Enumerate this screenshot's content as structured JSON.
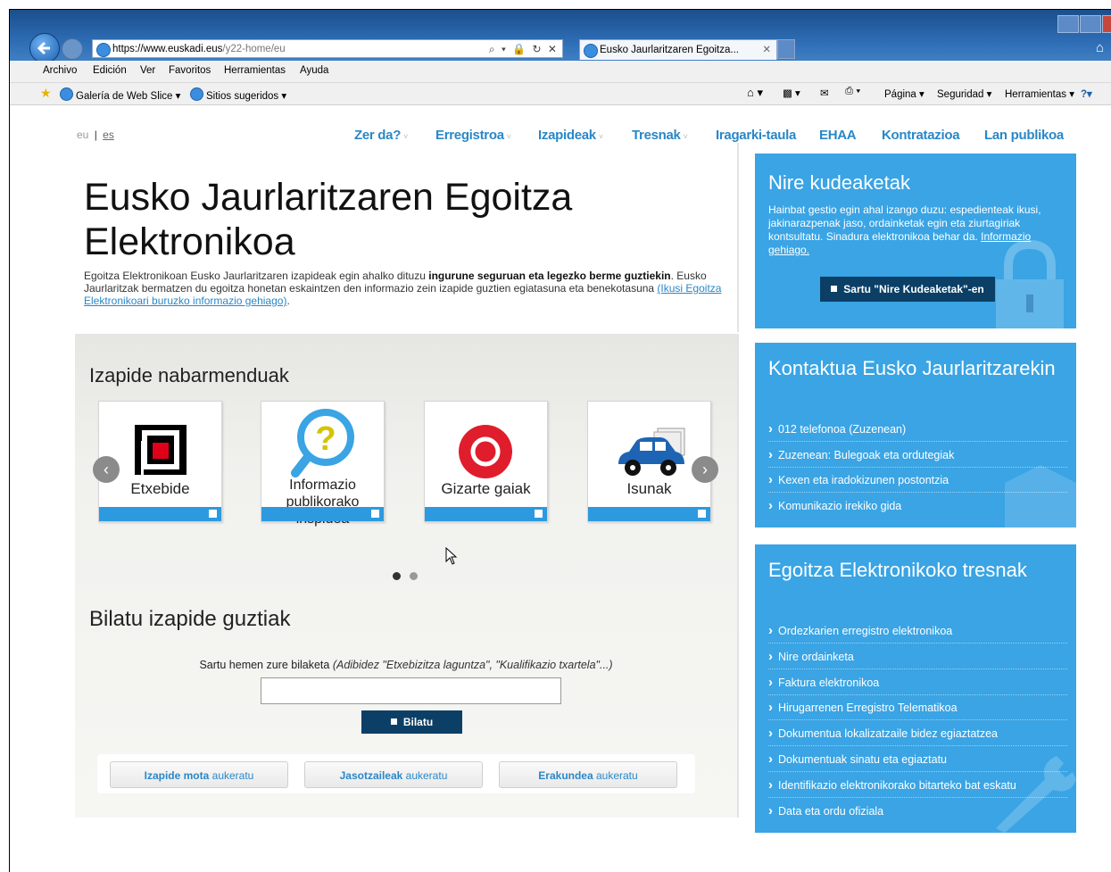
{
  "browser": {
    "url_host": "https://www.euskadi.eus",
    "url_path": "/y22-home/eu",
    "address_tools": "⌕ ▾ 🔒 ↻ ✕",
    "tab_title": "Eusko Jaurlaritzaren Egoitza...",
    "tab_close": "✕",
    "menu": [
      "Archivo",
      "Edición",
      "Ver",
      "Favoritos",
      "Herramientas",
      "Ayuda"
    ],
    "fav_gallery": "Galería de Web Slice ▾",
    "fav_sites": "Sitios sugeridos ▾",
    "cmd_page": "Página ▾",
    "cmd_security": "Seguridad ▾",
    "cmd_tools": "Herramientas ▾"
  },
  "lang": {
    "eu": "eu",
    "sep": "|",
    "es": "es"
  },
  "topnav": [
    {
      "label": "Zer da?",
      "caret": "˅"
    },
    {
      "label": "Erregistroa",
      "caret": "˅"
    },
    {
      "label": "Izapideak",
      "caret": "˅"
    },
    {
      "label": "Tresnak",
      "caret": "˅"
    },
    {
      "label": "Iragarki-taula"
    },
    {
      "label": "EHAA"
    },
    {
      "label": "Kontratazioa"
    },
    {
      "label": "Lan publikoa"
    }
  ],
  "hero": {
    "title": "Eusko Jaurlaritzaren Egoitza Elektronikoa",
    "intro_1": "Egoitza Elektronikoan Eusko Jaurlaritzaren izapideak egin ahalko dituzu ",
    "intro_bold": "ingurune seguruan eta legezko berme guztiekin",
    "intro_2": ". Eusko Jaurlaritzak bermatzen du egoitza honetan eskaintzen den informazio zein izapide guztien egiatasuna eta benekotasuna ",
    "intro_link": "(Ikusi Egoitza Elektronikoari buruzko informazio gehiago)",
    "intro_end": "."
  },
  "featured": {
    "title": "Izapide nabarmenduak",
    "prev": "‹",
    "next": "›",
    "cards": [
      {
        "label": "Etxebide"
      },
      {
        "label": "Informazio publikorako irispidea"
      },
      {
        "label": "Gizarte gaiak"
      },
      {
        "label": "Isunak"
      }
    ],
    "icon_question": "?"
  },
  "search": {
    "title": "Bilatu izapide guztiak",
    "hint": "Sartu hemen zure bilaketa ",
    "hint_example": "(Adibidez \"Etxebizitza laguntza\", \"Kualifikazio txartela\"...)",
    "value": "",
    "button": "Bilatu"
  },
  "filters": [
    {
      "bold": "Izapide mota",
      "rest": " aukeratu"
    },
    {
      "bold": "Jasotzaileak",
      "rest": " aukeratu"
    },
    {
      "bold": "Erakundea",
      "rest": " aukeratu"
    }
  ],
  "nire": {
    "title": "Nire kudeaketak",
    "desc": "Hainbat gestio egin ahal izango duzu: espedienteak ikusi, jakinarazpenak jaso, ordainketak egin eta ziurtagiriak kontsultatu. Sinadura elektronikoa behar da. ",
    "desc_link": "Informazio gehiago.",
    "button": "Sartu \"Nire Kudeaketak\"-en"
  },
  "kontaktua": {
    "title": "Kontaktua Eusko Jaurlaritzarekin",
    "links": [
      "012 telefonoa (Zuzenean)",
      "Zuzenean: Bulegoak eta ordutegiak",
      "Kexen eta iradokizunen postontzia",
      "Komunikazio irekiko gida"
    ]
  },
  "tresnak": {
    "title": "Egoitza Elektronikoko tresnak",
    "links": [
      "Ordezkarien erregistro elektronikoa",
      "Nire ordainketa",
      "Faktura elektronikoa",
      "Hirugarrenen Erregistro Telematikoa",
      "Dokumentua lokalizatzaile bidez egiaztatzea",
      "Dokumentuak sinatu eta egiaztatu",
      "Identifikazio elektronikorako bitarteko bat eskatu",
      "Data eta ordu ofiziala"
    ]
  },
  "colors": {
    "panel": "#3aa4e4",
    "link": "#2a87c8",
    "dark_button": "#0b3f66",
    "card_bar": "#2d9ae0"
  }
}
